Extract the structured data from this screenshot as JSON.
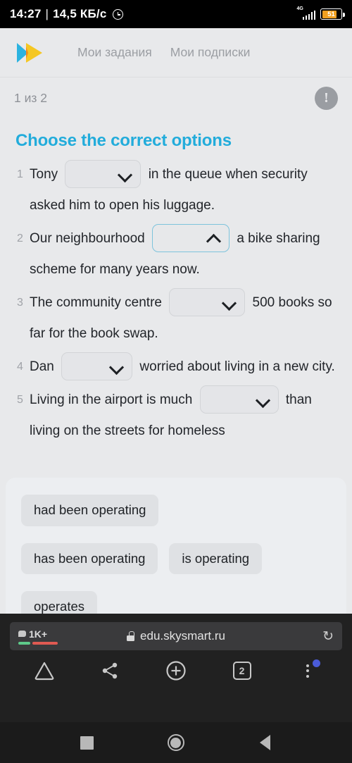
{
  "status_bar": {
    "time": "14:27",
    "separator": "|",
    "network_speed": "14,5 КБ/с",
    "alarm_icon": "alarm-clock-icon",
    "network_type": "4G",
    "battery_level": "51"
  },
  "site_header": {
    "logo_icon": "skysmart-double-chevron-logo",
    "nav": [
      {
        "label": "Мои задания"
      },
      {
        "label": "Мои подписки"
      }
    ]
  },
  "progress": {
    "text": "1 из 2",
    "warning_icon": "exclamation-circle-icon"
  },
  "exercise": {
    "title": "Choose the correct options",
    "title_color": "#22acdb",
    "questions": [
      {
        "number": "1",
        "before": "Tony",
        "after": "in the queue when security asked him to open his luggage.",
        "dropdown_state": "closed",
        "dropdown_icon": "chevron-down-icon",
        "dropdown_value": ""
      },
      {
        "number": "2",
        "before": "Our neighbourhood",
        "after": "a bike sharing scheme for many years now.",
        "dropdown_state": "open",
        "dropdown_icon": "chevron-up-icon",
        "dropdown_value": ""
      },
      {
        "number": "3",
        "before": "The community centre",
        "after": "500 books so far for the book swap.",
        "dropdown_state": "closed",
        "dropdown_icon": "chevron-down-icon",
        "dropdown_value": ""
      },
      {
        "number": "4",
        "before": "Dan",
        "after": "worried about living in a new city.",
        "dropdown_state": "closed",
        "dropdown_icon": "chevron-down-icon",
        "dropdown_value": ""
      },
      {
        "number": "5",
        "before": "Living in the airport is much",
        "after": "than living on the streets for homeless",
        "dropdown_state": "closed",
        "dropdown_icon": "chevron-down-icon",
        "dropdown_value": ""
      }
    ]
  },
  "option_panel": {
    "options": [
      {
        "label": "had been operating"
      },
      {
        "label": "has been operating"
      },
      {
        "label": "is operating"
      },
      {
        "label": "operates"
      }
    ]
  },
  "browser": {
    "url": "edu.skysmart.ru",
    "lock_icon": "lock-icon",
    "blocked_count": "1K+",
    "blocked_icon": "speech-bubble-icon",
    "reload_icon": "reload-icon",
    "toolbar": {
      "home_icon": "shield-home-icon",
      "share_icon": "share-icon",
      "new_tab_icon": "plus-circle-icon",
      "tab_count": "2",
      "menu_icon": "vertical-dots-menu-icon"
    }
  },
  "android_nav": {
    "recents_icon": "square-recents-icon",
    "home_icon": "circle-home-icon",
    "back_icon": "triangle-back-icon"
  }
}
